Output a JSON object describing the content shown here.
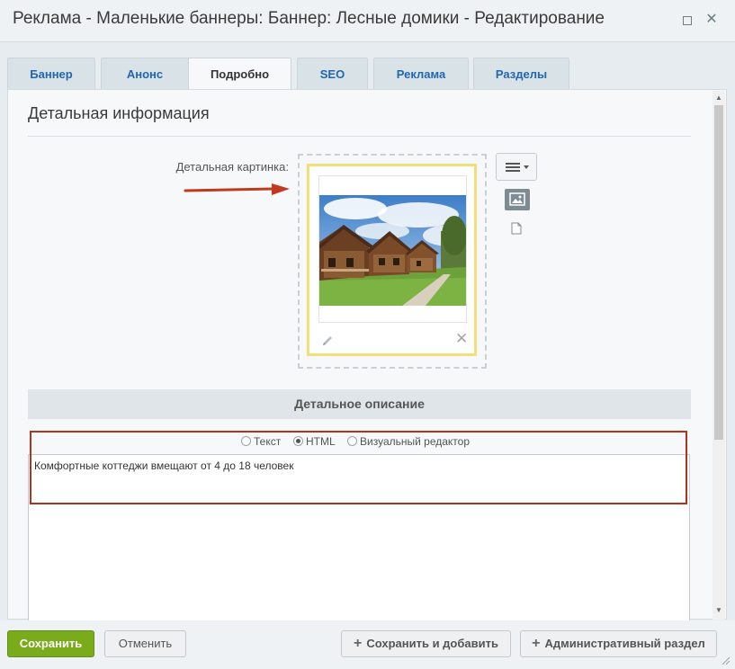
{
  "window": {
    "title": "Реклама - Маленькие баннеры: Баннер: Лесные домики - Редактирование",
    "maximize_icon": "square",
    "close_icon": "✕"
  },
  "tabs": [
    {
      "label": "Баннер",
      "active": false
    },
    {
      "label": "Анонс",
      "active": false
    },
    {
      "label": "Подробно",
      "active": true
    },
    {
      "label": "SEO",
      "active": false
    },
    {
      "label": "Реклама",
      "active": false
    },
    {
      "label": "Разделы",
      "active": false
    }
  ],
  "section": {
    "heading": "Детальная информация",
    "picture_label": "Детальная картинка:",
    "picture_alt": "Лесные домики"
  },
  "description": {
    "header": "Детальное описание",
    "modes": [
      {
        "label": "Текст",
        "checked": false
      },
      {
        "label": "HTML",
        "checked": true
      },
      {
        "label": "Визуальный редактор",
        "checked": false
      }
    ],
    "content": "Комфортные коттеджи вмещают от 4 до 18 человек"
  },
  "footer": {
    "save": "Сохранить",
    "cancel": "Отменить",
    "save_and_add": "Сохранить и добавить",
    "admin_section": "Административный раздел"
  },
  "colors": {
    "accent_save": "#7aab1a",
    "highlight_border": "#b0331a",
    "image_card_border": "#f4de77",
    "tab_link": "#2067b0"
  }
}
